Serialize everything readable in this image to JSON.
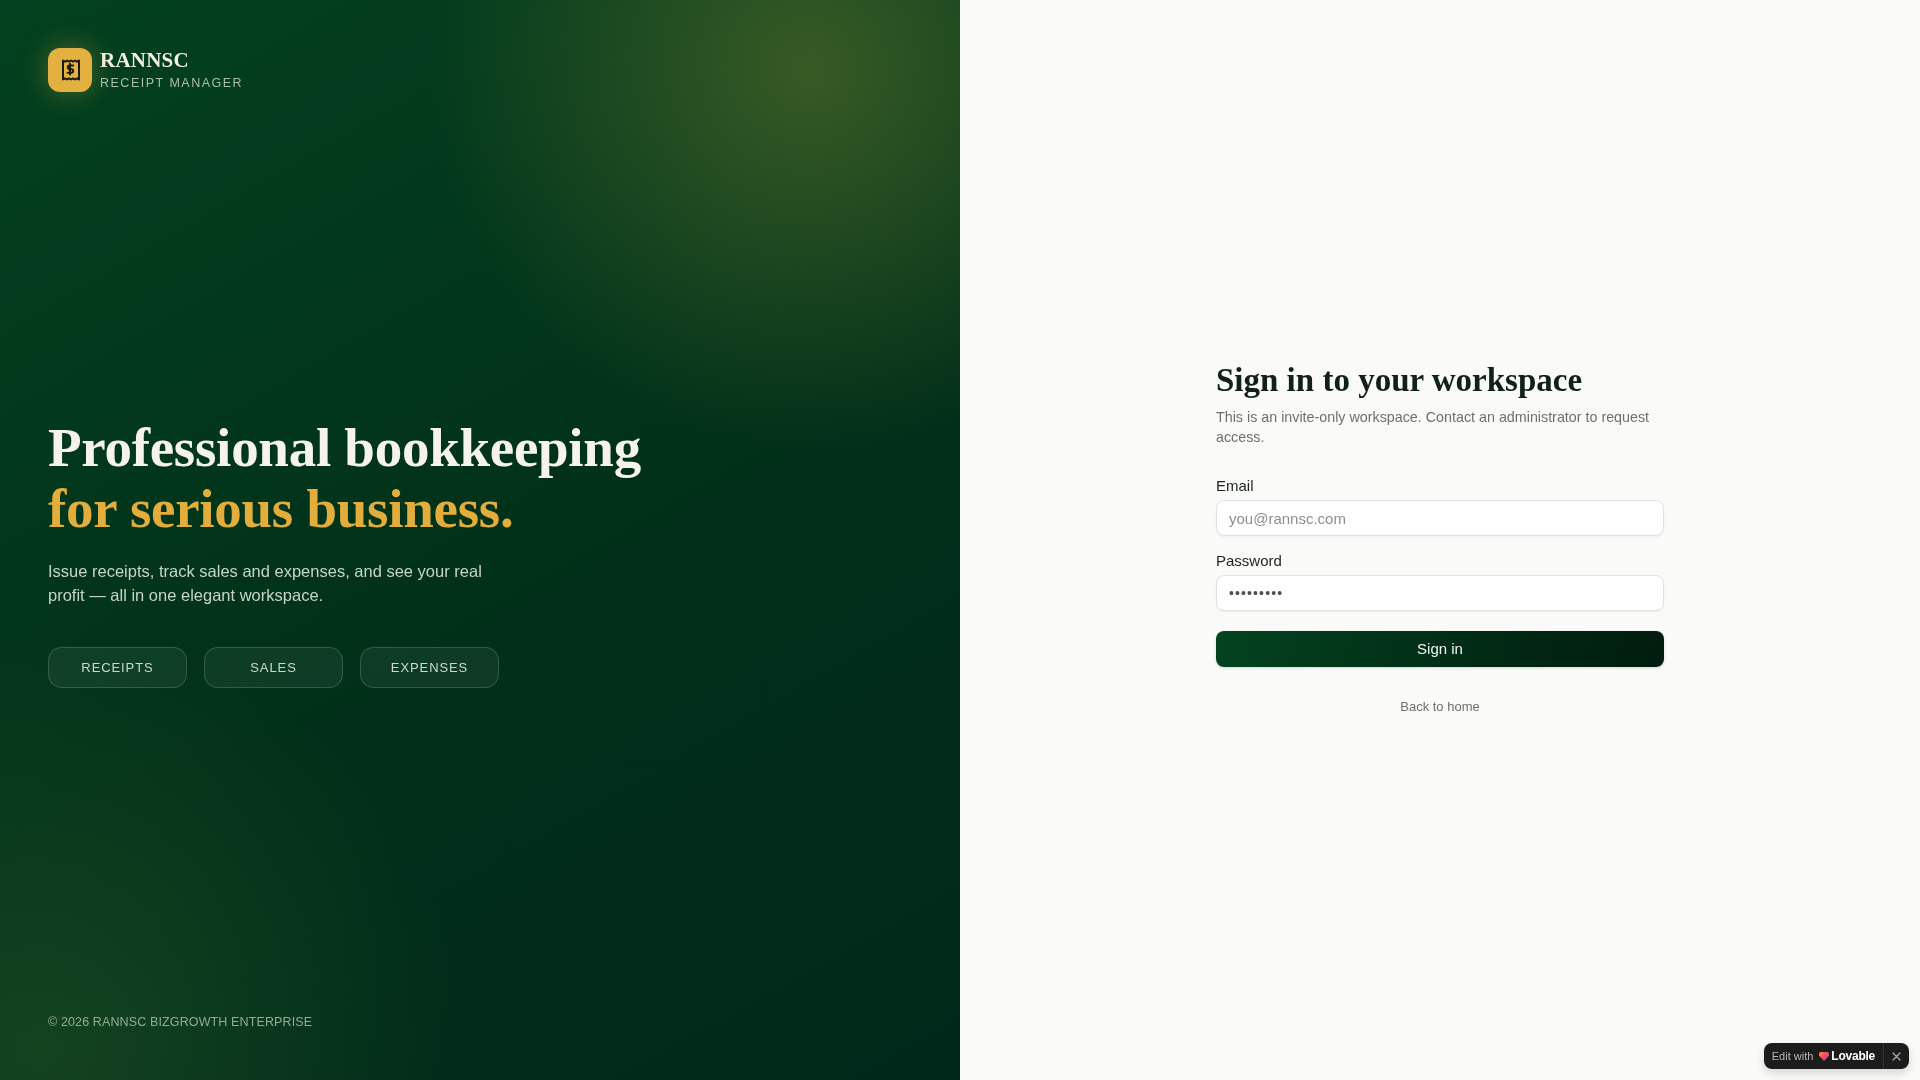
{
  "brand": {
    "name": "RANNSC",
    "tagline": "RECEIPT MANAGER"
  },
  "hero": {
    "headline": "Professional bookkeeping",
    "headline_accent": "for serious business.",
    "description": "Issue receipts, track sales and expenses, and see your real profit — all in one elegant workspace.",
    "features": [
      {
        "label": "RECEIPTS"
      },
      {
        "label": "SALES"
      },
      {
        "label": "EXPENSES"
      }
    ]
  },
  "footer": {
    "copyright": "© 2026 RANNSC BIZGROWTH ENTERPRISE"
  },
  "sign_in": {
    "title": "Sign in to your workspace",
    "subtitle": "This is an invite-only workspace. Contact an administrator to request access.",
    "fields": [
      {
        "kind": "email",
        "label": "Email",
        "placeholder": "you@rannsc.com"
      },
      {
        "kind": "password",
        "label": "Password",
        "value": "•••••••••"
      }
    ],
    "submit": "Sign in",
    "back_link": "Back to home"
  },
  "edit_badge": {
    "prefix": "Edit with",
    "brand": "Lovable"
  }
}
